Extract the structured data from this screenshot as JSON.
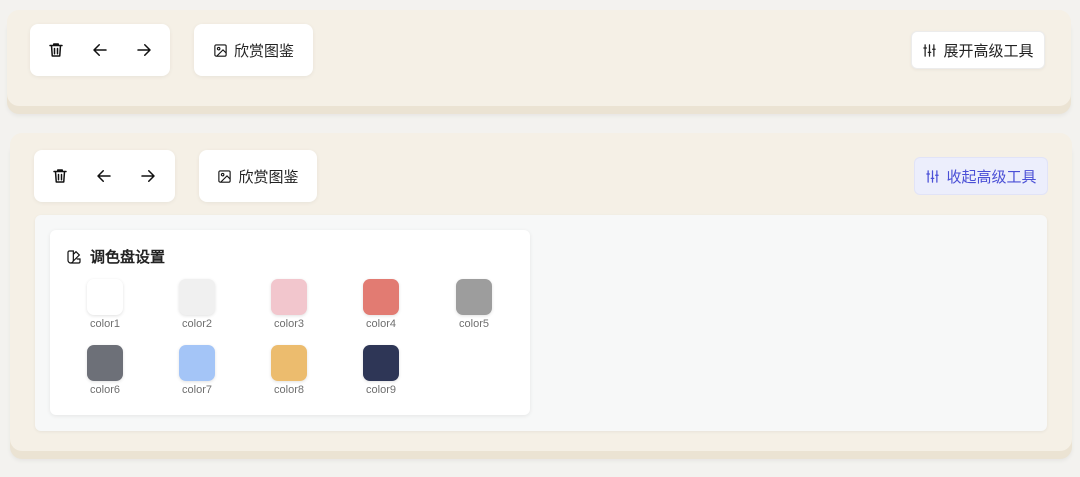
{
  "toolbar_top": {
    "gallery_label": "欣赏图鉴",
    "advanced_label": "展开高级工具"
  },
  "toolbar_bottom": {
    "gallery_label": "欣赏图鉴",
    "advanced_label": "收起高级工具"
  },
  "icons": {
    "delete": "trash-icon",
    "undo": "arrow-left-icon",
    "redo": "arrow-right-icon",
    "gallery": "image-icon",
    "advanced": "sliders-icon",
    "palette": "palette-icon"
  },
  "palette": {
    "title": "调色盘设置",
    "colors": [
      {
        "label": "color1",
        "hex": "#ffffff"
      },
      {
        "label": "color2",
        "hex": "#f0f0f0"
      },
      {
        "label": "color3",
        "hex": "#f2c6cd"
      },
      {
        "label": "color4",
        "hex": "#e27b72"
      },
      {
        "label": "color5",
        "hex": "#9d9d9d"
      },
      {
        "label": "color6",
        "hex": "#6d7078"
      },
      {
        "label": "color7",
        "hex": "#a4c5f7"
      },
      {
        "label": "color8",
        "hex": "#ecbc6e"
      },
      {
        "label": "color9",
        "hex": "#2e3656"
      }
    ]
  },
  "colors": {
    "panel_bg": "#f5f0e6",
    "accent": "#4a4fd6",
    "accent_bg": "#eceefc"
  }
}
